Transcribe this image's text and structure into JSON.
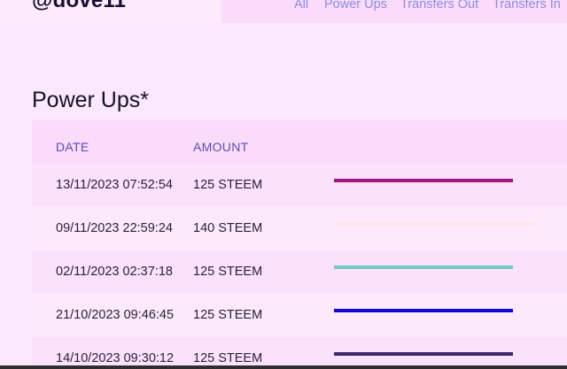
{
  "header": {
    "username": "@dove11"
  },
  "nav": {
    "tabs": [
      {
        "label": "All"
      },
      {
        "label": "Power Ups"
      },
      {
        "label": "Transfers Out"
      },
      {
        "label": "Transfers In"
      }
    ]
  },
  "page": {
    "title": "Power Ups*"
  },
  "table": {
    "columns": [
      "DATE",
      "AMOUNT"
    ],
    "rows": [
      {
        "date": "13/11/2023 07:52:54",
        "amount": "125 STEEM",
        "bar_color": "#a0177e",
        "bar_fraction": 0.895
      },
      {
        "date": "09/11/2023 22:59:24",
        "amount": "140 STEEM",
        "bar_color": "#fde7e4",
        "bar_fraction": 1.0
      },
      {
        "date": "02/11/2023 02:37:18",
        "amount": "125 STEEM",
        "bar_color": "#72c7c8",
        "bar_fraction": 0.895
      },
      {
        "date": "21/10/2023 09:46:45",
        "amount": "125 STEEM",
        "bar_color": "#1205d7",
        "bar_fraction": 0.895
      },
      {
        "date": "14/10/2023 09:30:12",
        "amount": "125 STEEM",
        "bar_color": "#3e2a68",
        "bar_fraction": 0.895
      }
    ]
  }
}
